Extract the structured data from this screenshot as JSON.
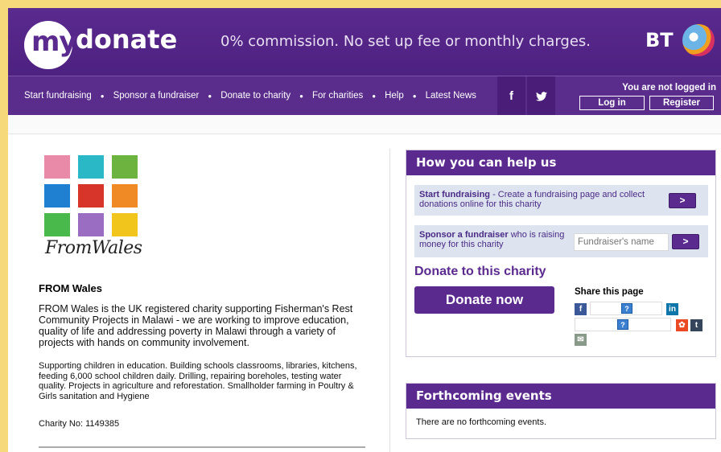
{
  "header": {
    "logo_my": "my",
    "logo_donate": "donate",
    "tagline": "0% commission. No set up fee or monthly charges.",
    "bt_logo": "BT"
  },
  "nav": {
    "items": [
      "Start fundraising",
      "Sponsor a fundraiser",
      "Donate to charity",
      "For charities",
      "Help",
      "Latest News"
    ],
    "facebook": "f",
    "twitter": "t",
    "login_status": "You are not logged in",
    "login_label": "Log in",
    "register_label": "Register"
  },
  "charity": {
    "logo_text": "FromWales",
    "name": "FROM Wales",
    "description": "FROM Wales is the UK registered charity supporting Fisherman's Rest Community Projects in Malawi - we are working to improve education, quality of life and addressing poverty in Malawi through a variety of projects with hands on community involvement.",
    "details": "Supporting children in education. Building schools classrooms, libraries, kitchens, feeding 6,000 school children daily. Drilling, repairing boreholes, testing water quality. Projects in agriculture and reforestation. Smallholder farming in Poultry & Girls sanitation and Hygiene",
    "charity_no": "Charity No:  1149385"
  },
  "help_panel": {
    "title": "How you can help us",
    "start_bold": "Start fundraising",
    "start_text": " - Create a fundraising page and collect donations online for this charity",
    "sponsor_bold": "Sponsor a fundraiser",
    "sponsor_text": " who is raising money for this charity",
    "fundraiser_placeholder": "Fundraiser's name",
    "go_label": ">",
    "donate_heading": "Donate to this charity",
    "donate_button": "Donate now",
    "share_title": "Share this page",
    "qmark": "?"
  },
  "events_panel": {
    "title": "Forthcoming events",
    "empty_text": "There are no forthcoming events."
  },
  "colors": {
    "brand_purple": "#5b2a8f",
    "row_bg": "#dde4ef"
  }
}
